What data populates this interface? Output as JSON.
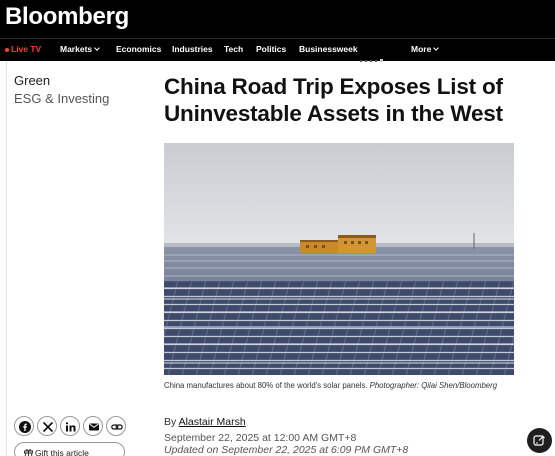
{
  "header": {
    "logo": "Bloomberg"
  },
  "nav": {
    "items": [
      {
        "label": "Live TV"
      },
      {
        "label": "Markets"
      },
      {
        "label": "Economics"
      },
      {
        "label": "Industries"
      },
      {
        "label": "Tech"
      },
      {
        "label": "Politics"
      },
      {
        "label": "Businessweek"
      },
      {
        "label": "More"
      }
    ]
  },
  "section": {
    "name": "Green",
    "subsection": "ESG & Investing"
  },
  "article": {
    "headline": "China Road Trip Exposes List of Uninvestable Assets in the West",
    "caption_text": "China manufactures about 80% of the world's solar panels. ",
    "caption_credit": "Photographer: Qilai Shen/Bloomberg",
    "byline_prefix": "By ",
    "author": "Alastair Marsh",
    "published": "September 22, 2025 at 12:00 AM GMT+8",
    "updated": "Updated on September 22, 2025 at 6:09 PM GMT+8"
  },
  "share": {
    "icons": [
      "facebook-icon",
      "x-icon",
      "linkedin-icon",
      "email-icon",
      "link-icon"
    ],
    "gift_label": "Gift this article"
  },
  "colors": {
    "header_bg": "#000000",
    "live": "#ff3b30",
    "text": "#111111"
  }
}
